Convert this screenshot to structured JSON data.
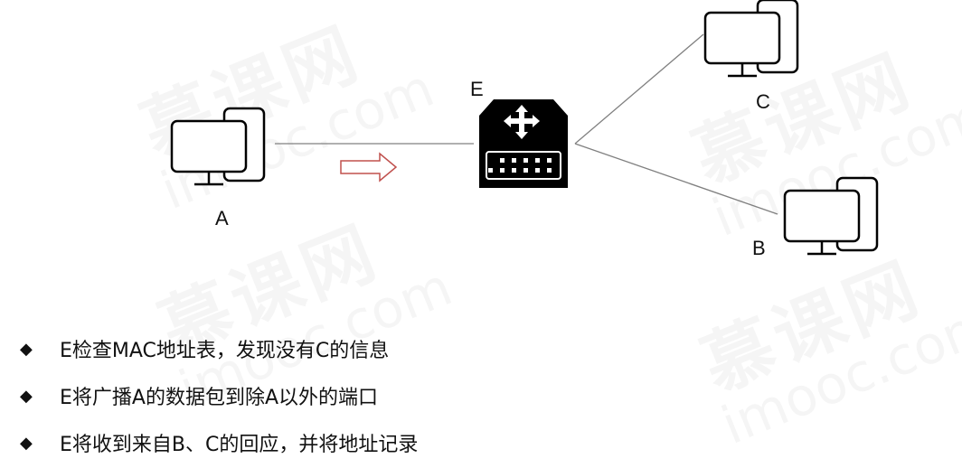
{
  "watermark": {
    "brand": "慕课网",
    "domain": "imooc.com"
  },
  "nodes": {
    "a": "A",
    "b": "B",
    "c": "C",
    "e": "E"
  },
  "icons": {
    "computer": "computer-icon",
    "switch": "network-switch-icon",
    "arrow": "direction-arrow-icon",
    "bullet": "diamond-bullet-icon"
  },
  "colors": {
    "line": "#808080",
    "arrow": "#c0504d",
    "switch": "#000000"
  },
  "bullet_symbol": "◆",
  "bullets": [
    "E检查MAC地址表，发现没有C的信息",
    "E将广播A的数据包到除A以外的端口",
    "E将收到来自B、C的回应，并将地址记录"
  ]
}
